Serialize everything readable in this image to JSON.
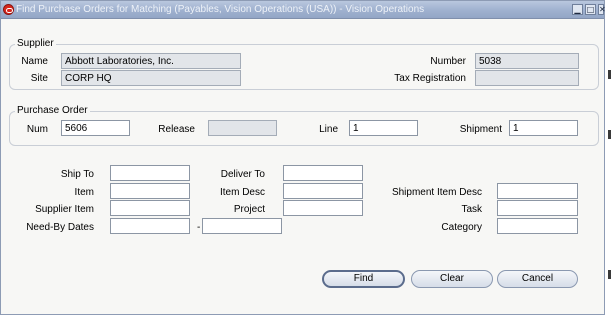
{
  "window": {
    "title": "Find Purchase Orders for Matching (Payables, Vision Operations (USA)) - Vision Operations",
    "minimize_glyph": "▁",
    "maximize_glyph": "□",
    "close_glyph": "✕",
    "app_icon": "oracle-icon"
  },
  "supplier": {
    "group_label": "Supplier",
    "name_label": "Name",
    "name_value": "Abbott Laboratories, Inc.",
    "site_label": "Site",
    "site_value": "CORP HQ",
    "number_label": "Number",
    "number_value": "5038",
    "tax_label": "Tax Registration",
    "tax_value": ""
  },
  "purchase_order": {
    "group_label": "Purchase Order",
    "num_label": "Num",
    "num_value": "5606",
    "release_label": "Release",
    "release_value": "",
    "line_label": "Line",
    "line_value": "1",
    "shipment_label": "Shipment",
    "shipment_value": "1"
  },
  "criteria": {
    "ship_to_label": "Ship To",
    "item_label": "Item",
    "supplier_item_label": "Supplier Item",
    "need_by_label": "Need-By Dates",
    "date_separator": "-",
    "deliver_to_label": "Deliver To",
    "item_desc_label": "Item Desc",
    "project_label": "Project",
    "shipment_item_desc_label": "Shipment Item Desc",
    "task_label": "Task",
    "category_label": "Category"
  },
  "buttons": {
    "find": "Find",
    "clear": "Clear",
    "cancel": "Cancel"
  },
  "colors": {
    "titlebar": "#9fb1cf",
    "readonly_field": "#e2e5e9",
    "window_bg": "#f7f7f5"
  }
}
